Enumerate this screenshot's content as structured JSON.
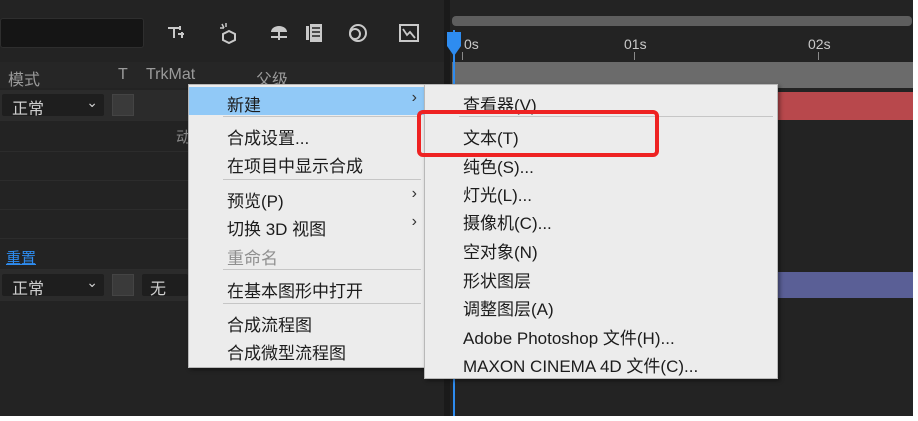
{
  "timeline": {
    "columns": {
      "mode": "模式",
      "t": "T",
      "trkmat": "TrkMat",
      "parent": "父级"
    },
    "rows": [
      {
        "mode": "正常"
      },
      {
        "reset_link": "重置",
        "mode": "正常",
        "trkmat": "无"
      }
    ],
    "partial_label": "动",
    "ruler": {
      "t0": "0s",
      "t1": "01s",
      "t2": "02s"
    },
    "colors": {
      "accent": "#2e8cf0",
      "layer_red": "#b8484c",
      "layer_blue": "#5a5f96"
    }
  },
  "context_menu": {
    "items": [
      {
        "label": "新建",
        "submenu": true,
        "highlighted": true
      },
      {
        "label": "合成设置..."
      },
      {
        "label": "在项目中显示合成"
      },
      {
        "label": "预览(P)",
        "submenu": true
      },
      {
        "label": "切换 3D 视图",
        "submenu": true
      },
      {
        "label": "重命名",
        "disabled": true
      },
      {
        "label": "在基本图形中打开"
      },
      {
        "label": "合成流程图"
      },
      {
        "label": "合成微型流程图"
      }
    ],
    "arrow": "›"
  },
  "submenu": {
    "items": [
      {
        "label": "查看器(V)"
      },
      {
        "label": "文本(T)",
        "annotated": true
      },
      {
        "label": "纯色(S)..."
      },
      {
        "label": "灯光(L)..."
      },
      {
        "label": "摄像机(C)..."
      },
      {
        "label": "空对象(N)"
      },
      {
        "label": "形状图层"
      },
      {
        "label": "调整图层(A)"
      },
      {
        "label": "Adobe Photoshop 文件(H)..."
      },
      {
        "label": "MAXON CINEMA 4D 文件(C)..."
      }
    ]
  },
  "icons": {
    "chevron": "⌄"
  }
}
